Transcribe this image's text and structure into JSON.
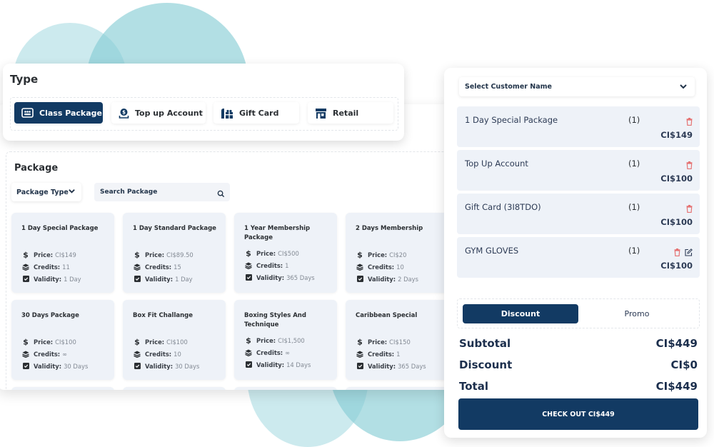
{
  "type_section": {
    "title": "Type",
    "buttons": [
      {
        "label": "Class Package",
        "icon": "class-package-icon",
        "active": true
      },
      {
        "label": "Top up Account",
        "icon": "top-up-icon",
        "active": false
      },
      {
        "label": "Gift Card",
        "icon": "gift-card-icon",
        "active": false
      },
      {
        "label": "Retail",
        "icon": "store-icon",
        "active": false
      }
    ]
  },
  "package_section": {
    "title": "Package",
    "type_filter": "Package Type",
    "search_placeholder": "Search Package",
    "labels": {
      "price": "Price:",
      "credits": "Credits:",
      "validity": "Validity:"
    },
    "cards": [
      {
        "name": "1 Day Special Package",
        "price": "CI$149",
        "credits": "11",
        "validity": "1 Day"
      },
      {
        "name": "1 Day Standard Package",
        "price": "CI$89.50",
        "credits": "15",
        "validity": "1 Day"
      },
      {
        "name": "1 Year Membership Package",
        "price": "CI$500",
        "credits": "1",
        "validity": "365 Days"
      },
      {
        "name": "2 Days Membership",
        "price": "CI$20",
        "credits": "10",
        "validity": "2 Days"
      },
      {
        "name": "30 Days Package",
        "price": "CI$100",
        "credits": "∞",
        "validity": "30 Days"
      },
      {
        "name": "Box Fit Challange",
        "price": "CI$100",
        "credits": "10",
        "validity": "30 Days"
      },
      {
        "name": "Boxing Styles And Technique",
        "price": "CI$1,500",
        "credits": "∞",
        "validity": "14 Days"
      },
      {
        "name": "Caribbean Special",
        "price": "CI$150",
        "credits": "1",
        "validity": "365 Days"
      }
    ]
  },
  "cart": {
    "customer_select": "Select Customer Name",
    "items": [
      {
        "name": "1 Day Special Package",
        "qty": "(1)",
        "price": "CI$149",
        "editable": false
      },
      {
        "name": "Top Up Account",
        "qty": "(1)",
        "price": "CI$100",
        "editable": false
      },
      {
        "name": "Gift Card (3I8TDO)",
        "qty": "(1)",
        "price": "CI$100",
        "editable": false
      },
      {
        "name": "GYM GLOVES",
        "qty": "(1)",
        "price": "CI$100",
        "editable": true
      }
    ],
    "tabs": {
      "discount": "Discount",
      "promo": "Promo"
    },
    "summary": {
      "subtotal_label": "Subtotal",
      "subtotal": "CI$449",
      "discount_label": "Discount",
      "discount": "CI$0",
      "total_label": "Total",
      "total": "CI$449"
    },
    "checkout_label": "CHECK OUT CI$449"
  },
  "colors": {
    "primary": "#123a63",
    "delete": "#e57373",
    "card_bg": "#eef2f8",
    "accent_circle": "#82ccd4"
  }
}
